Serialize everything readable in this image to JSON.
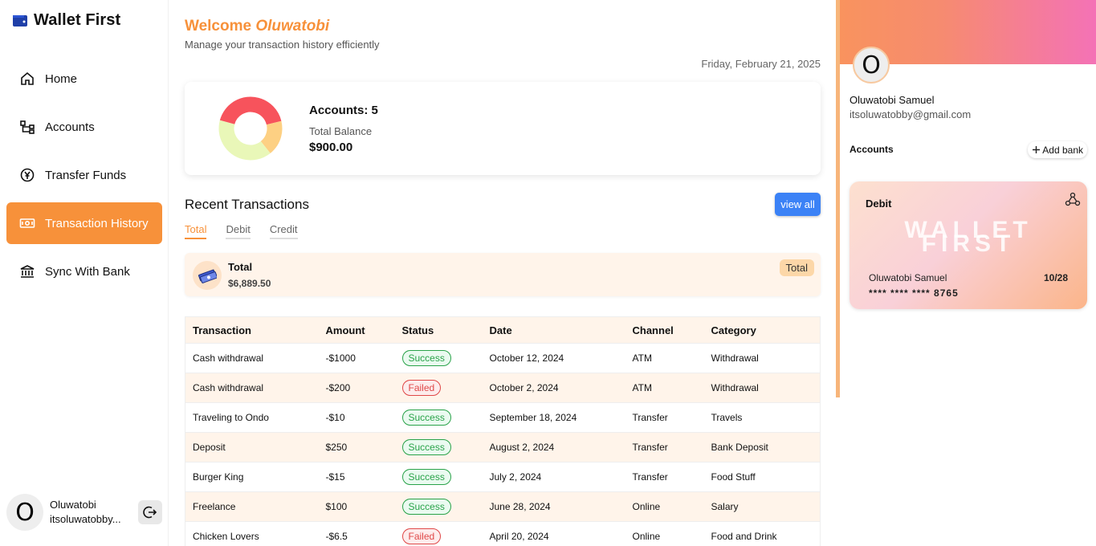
{
  "app": {
    "name": "Wallet First"
  },
  "sidebar": {
    "items": [
      {
        "label": "Home",
        "icon": "home-icon"
      },
      {
        "label": "Accounts",
        "icon": "accounts-icon"
      },
      {
        "label": "Transfer Funds",
        "icon": "transfer-icon"
      },
      {
        "label": "Transaction History",
        "icon": "money-icon",
        "active": true
      },
      {
        "label": "Sync With Bank",
        "icon": "bank-icon"
      }
    ],
    "user": {
      "name": "Oluwatobi",
      "email": "itsoluwatobby...",
      "avatar_letter": "O"
    }
  },
  "header": {
    "welcome_prefix": "Welcome",
    "welcome_name": "Oluwatobi",
    "subtitle": "Manage your transaction history efficiently",
    "date": "Friday, February 21, 2025"
  },
  "summary": {
    "accounts_label": "Accounts: 5",
    "total_balance_label": "Total Balance",
    "total_balance_value": "$900.00",
    "donut_colors": [
      "#f7535c",
      "#fdd083",
      "#e9f7b8"
    ]
  },
  "recent": {
    "title": "Recent Transactions",
    "view_all": "view all",
    "tabs": [
      "Total",
      "Debit",
      "Credit"
    ],
    "total_card": {
      "label": "Total",
      "value": "$6,889.50",
      "badge": "Total"
    }
  },
  "table": {
    "headers": [
      "Transaction",
      "Amount",
      "Status",
      "Date",
      "Channel",
      "Category"
    ],
    "rows": [
      {
        "transaction": "Cash withdrawal",
        "amount": "-$1000",
        "status": "Success",
        "date": "October 12, 2024",
        "channel": "ATM",
        "category": "Withdrawal"
      },
      {
        "transaction": "Cash withdrawal",
        "amount": "-$200",
        "status": "Failed",
        "date": "October 2, 2024",
        "channel": "ATM",
        "category": "Withdrawal"
      },
      {
        "transaction": "Traveling to Ondo",
        "amount": "-$10",
        "status": "Success",
        "date": "September 18, 2024",
        "channel": "Transfer",
        "category": "Travels"
      },
      {
        "transaction": "Deposit",
        "amount": "$250",
        "status": "Success",
        "date": "August 2, 2024",
        "channel": "Transfer",
        "category": "Bank Deposit"
      },
      {
        "transaction": "Burger King",
        "amount": "-$15",
        "status": "Success",
        "date": "July 2, 2024",
        "channel": "Transfer",
        "category": "Food Stuff"
      },
      {
        "transaction": "Freelance",
        "amount": "$100",
        "status": "Success",
        "date": "June 28, 2024",
        "channel": "Online",
        "category": "Salary"
      },
      {
        "transaction": "Chicken Lovers",
        "amount": "-$6.5",
        "status": "Failed",
        "date": "April 20, 2024",
        "channel": "Online",
        "category": "Food and Drink"
      }
    ]
  },
  "profile": {
    "avatar_letter": "O",
    "name": "Oluwatobi Samuel",
    "email": "itsoluwatobby@gmail.com",
    "accounts_label": "Accounts",
    "add_bank_label": "Add bank"
  },
  "card": {
    "type": "Debit",
    "brand_line1": "WALLET",
    "brand_line2": "FIRST",
    "holder": "Oluwatobi Samuel",
    "expiry": "10/28",
    "number": "**** **** **** 8765"
  }
}
